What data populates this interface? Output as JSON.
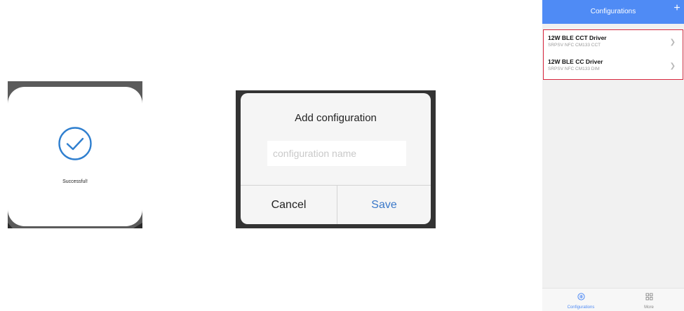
{
  "success_dialog": {
    "message": "Successful!"
  },
  "add_configuration_dialog": {
    "title": "Add configuration",
    "input_placeholder": "configuration name",
    "cancel_label": "Cancel",
    "save_label": "Save",
    "accent_color": "#3a78c9"
  },
  "configurations_screen": {
    "header_title": "Configurations",
    "header_color": "#4f8bf5",
    "add_icon": "plus-icon",
    "items": [
      {
        "name": "12W BLE CCT Driver",
        "subtitle": "SRPSV NFC CM133 CCT"
      },
      {
        "name": "12W BLE CC Driver",
        "subtitle": "SRPSV NFC CM133 DIM"
      }
    ],
    "tabs": [
      {
        "label": "Configurations",
        "icon": "configurations-icon",
        "active": true
      },
      {
        "label": "More",
        "icon": "grid-icon",
        "active": false
      }
    ]
  }
}
